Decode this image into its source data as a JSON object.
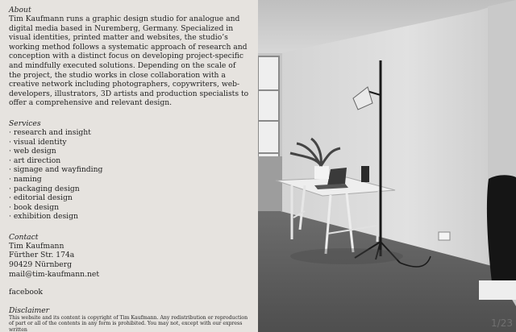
{
  "about": {
    "heading": "About",
    "text": "Tim Kaufmann runs a graphic design studio for analogue and digital media based in Nuremberg, Germany. Specialized in visual identities, printed matter and websites, the studio’s working method follows a systematic approach of research and conception with a distinct focus on developing project-specific and mindfully executed solutions. Depending on the scale of the project, the studio works in close collaboration with a creative network including photographers, copywriters, web-developers, illustrators, 3D artists and production specialists to offer a comprehensive and relevant design."
  },
  "services": {
    "heading": "Services",
    "items": [
      "· research and insight",
      "· visual identity",
      "· web design",
      "· art direction",
      "· signage and wayfinding",
      "· naming",
      "· packaging design",
      "· editorial design",
      "· book design",
      "· exhibition design"
    ]
  },
  "contact": {
    "heading": "Contact",
    "name": "Tim Kaufmann",
    "street": "Fürther Str. 174a",
    "city": "90429 Nürnberg",
    "email": "mail@tim-kaufmann.net"
  },
  "social": {
    "facebook": "facebook"
  },
  "disclaimer": {
    "heading": "Disclaimer",
    "text": "This website and its content is copyright of Tim Kaufmann. Any redistribution or reproduction of part or all of the contents in any form is prohibited. You may not, except with our express written"
  },
  "photo": {
    "counter": "1/23"
  }
}
